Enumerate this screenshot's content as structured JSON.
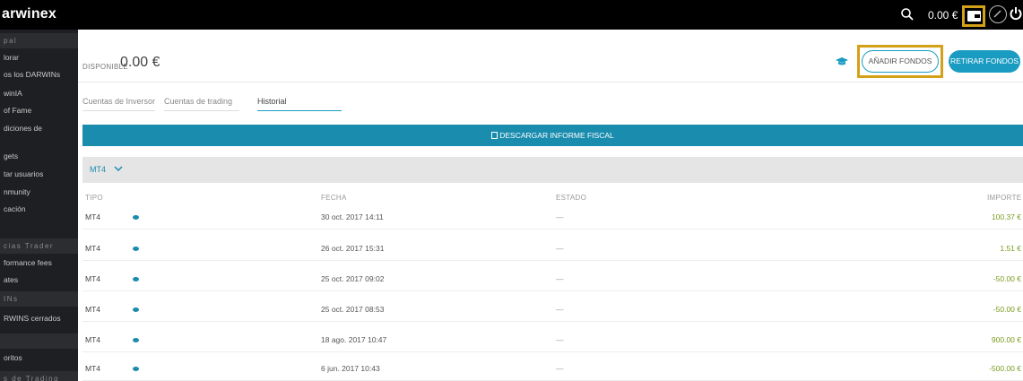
{
  "topbar": {
    "logo": "arwinex",
    "balance": "0.00 €",
    "icons": [
      "search-icon",
      "wallet-icon",
      "gauge-icon",
      "power-icon"
    ]
  },
  "sidebar": {
    "sections": [
      "pal",
      "cias Trader",
      "INs",
      "",
      "s de Trading"
    ],
    "items": [
      "lorar",
      "os los DARWINs",
      "winIA",
      "of Fame",
      "diciones de",
      "gets",
      "tar usuarios",
      "nmunity",
      "cación",
      "formance fees",
      "ates",
      "RWINS cerrados",
      "oritos"
    ]
  },
  "header": {
    "disponible_label": "DISPONIBLE",
    "disponible_value": "0.00 €",
    "add_funds": "AÑADIR FONDOS",
    "withdraw_funds": "RETIRAR FONDOS"
  },
  "tabs": [
    {
      "label": "Cuentas de Inversor",
      "active": false
    },
    {
      "label": "Cuentas de trading",
      "active": false
    },
    {
      "label": "Historial",
      "active": true
    }
  ],
  "fiscal_button": "DESCARGAR INFORME FISCAL",
  "account_selector": "MT4",
  "table": {
    "headers": {
      "tipo": "TIPO",
      "fecha": "FECHA",
      "estado": "ESTADO",
      "importe": "IMPORTE"
    },
    "rows": [
      {
        "tipo": "MT4",
        "fecha": "30 oct. 2017 14:11",
        "estado": "—",
        "importe": "100.37 €"
      },
      {
        "tipo": "MT4",
        "fecha": "26 oct. 2017 15:31",
        "estado": "—",
        "importe": "1.51 €"
      },
      {
        "tipo": "MT4",
        "fecha": "25 oct. 2017 09:02",
        "estado": "—",
        "importe": "-50.00 €"
      },
      {
        "tipo": "MT4",
        "fecha": "25 oct. 2017 08:53",
        "estado": "—",
        "importe": "-50.00 €"
      },
      {
        "tipo": "MT4",
        "fecha": "18 ago. 2017 10:47",
        "estado": "—",
        "importe": "900.00 €"
      },
      {
        "tipo": "MT4",
        "fecha": "6 jun. 2017 10:43",
        "estado": "—",
        "importe": "-500.00 €"
      }
    ]
  },
  "colors": {
    "accent": "#1a9cc2",
    "highlight": "#d4a017",
    "amount": "#7a9b1e",
    "sidebar_bg": "#1e1f22"
  }
}
